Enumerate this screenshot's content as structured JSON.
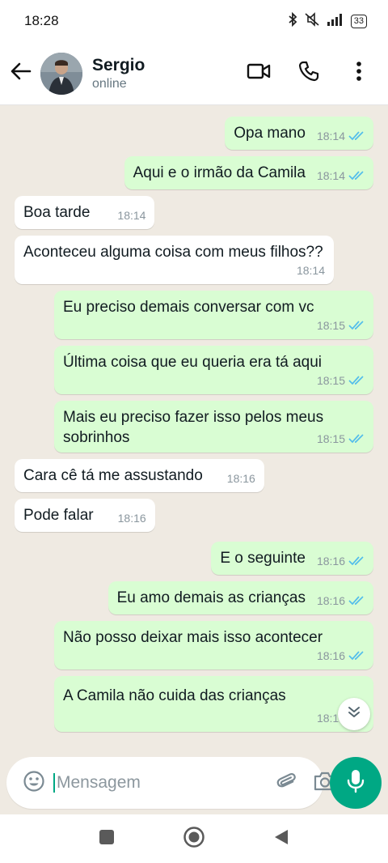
{
  "status_bar": {
    "time": "18:28",
    "battery": "33"
  },
  "header": {
    "contact_name": "Sergio",
    "contact_status": "online"
  },
  "colors": {
    "outgoing_bubble": "#d9fdd3",
    "incoming_bubble": "#ffffff",
    "read_ticks": "#53bdeb",
    "accent": "#00a884",
    "chat_background": "#efeae2"
  },
  "messages": [
    {
      "direction": "out",
      "text": "Opa mano",
      "time": "18:14",
      "status": "read"
    },
    {
      "direction": "out",
      "text": "Aqui e o irmão da Camila",
      "time": "18:14",
      "status": "read"
    },
    {
      "direction": "in",
      "text": "Boa tarde",
      "time": "18:14"
    },
    {
      "direction": "in",
      "text": "Aconteceu alguma coisa com meus filhos??",
      "time": "18:14"
    },
    {
      "direction": "out",
      "text": "Eu preciso demais conversar com vc",
      "time": "18:15",
      "status": "read"
    },
    {
      "direction": "out",
      "text": "Última coisa que eu queria era tá aqui",
      "time": "18:15",
      "status": "read"
    },
    {
      "direction": "out",
      "text": "Mais eu preciso fazer isso pelos meus sobrinhos",
      "time": "18:15",
      "status": "read"
    },
    {
      "direction": "in",
      "text": "Cara cê tá me assustando",
      "time": "18:16"
    },
    {
      "direction": "in",
      "text": "Pode falar",
      "time": "18:16"
    },
    {
      "direction": "out",
      "text": "E o seguinte",
      "time": "18:16",
      "status": "read"
    },
    {
      "direction": "out",
      "text": "Eu amo demais as crianças",
      "time": "18:16",
      "status": "read"
    },
    {
      "direction": "out",
      "text": "Não posso deixar mais isso acontecer",
      "time": "18:16",
      "status": "read"
    },
    {
      "direction": "out",
      "text": "A Camila não cuida das crianças",
      "time": "18:16",
      "status": "read"
    }
  ],
  "composer": {
    "placeholder": "Mensagem"
  },
  "icons": {
    "back": "arrow-left-icon",
    "video_call": "video-camera-icon",
    "voice_call": "phone-icon",
    "menu": "more-vertical-icon",
    "emoji": "emoji-icon",
    "attach": "paperclip-icon",
    "camera": "camera-icon",
    "mic": "microphone-icon",
    "scroll_down": "double-chevron-down-icon"
  }
}
